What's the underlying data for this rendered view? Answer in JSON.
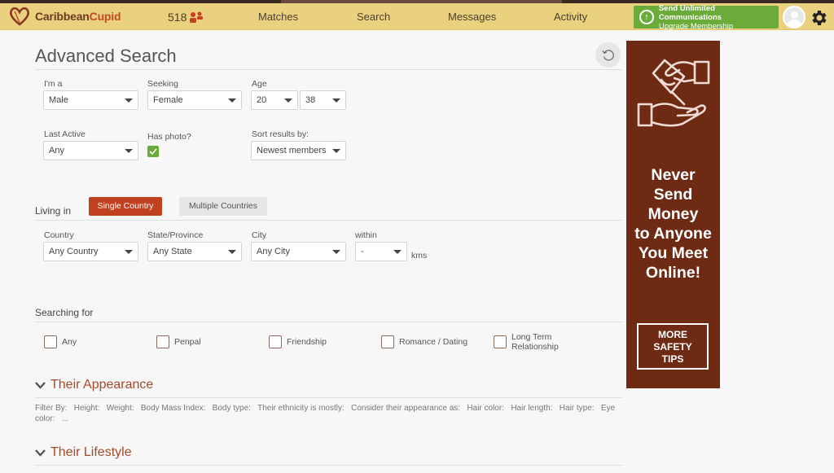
{
  "navbar": {
    "logo_part1": "Caribbean",
    "logo_part2": "Cupid",
    "online_count": "518",
    "nav_items": [
      "Matches",
      "Search",
      "Messages",
      "Activity"
    ],
    "upgrade_title": "Send Unlimited Communications",
    "upgrade_subtitle": "Upgrade Membership",
    "upgrade_icon": "arrow-up-circle-icon",
    "avatar_icon": "user-avatar-icon",
    "settings_icon": "gear-icon"
  },
  "page": {
    "title": "Advanced Search",
    "reset_icon": "reset-icon"
  },
  "basics": {
    "im_a_label": "I'm a",
    "im_a_value": "Male",
    "seeking_label": "Seeking",
    "seeking_value": "Female",
    "age_label": "Age",
    "age_min": "20",
    "age_max": "38",
    "last_active_label": "Last Active",
    "last_active_value": "Any",
    "has_photo_label": "Has photo?",
    "has_photo_checked": true,
    "sort_label": "Sort results by:",
    "sort_value": "Newest members"
  },
  "location": {
    "living_in_label": "Living in",
    "tab_single": "Single Country",
    "tab_multiple": "Multiple Countries",
    "active_tab": "Single Country",
    "country_label": "Country",
    "country_value": "Any Country",
    "state_label": "State/Province",
    "state_value": "Any State",
    "city_label": "City",
    "city_value": "Any City",
    "within_label": "within",
    "within_value": "-",
    "unit": "kms"
  },
  "searching_for": {
    "label": "Searching for",
    "options": [
      {
        "label": "Any",
        "checked": false
      },
      {
        "label": "Penpal",
        "checked": false
      },
      {
        "label": "Friendship",
        "checked": false
      },
      {
        "label": "Romance / Dating",
        "checked": false
      },
      {
        "label": "Long Term Relationship",
        "checked": false
      }
    ]
  },
  "sections": {
    "appearance_title": "Their Appearance",
    "appearance_filters": "Filter By:   Height:   Weight:   Body Mass Index:   Body type:   Their ethnicity is mostly:   Consider their appearance as:   Hair color:   Hair length:   Hair type:   Eye color:   ...",
    "lifestyle_title": "Their Lifestyle"
  },
  "ad": {
    "icon": "hands-money-icon",
    "headline": "Never Send Money to Anyone You Meet Online!",
    "headline_lines": [
      "Never",
      "Send",
      "Money",
      "to Anyone",
      "You Meet",
      "Online!"
    ],
    "button_lines": [
      "MORE",
      "SAFETY",
      "TIPS"
    ],
    "background": "#6f2a14"
  },
  "colors": {
    "navbar": "#ead17f",
    "accent": "#c0401f",
    "upgrade_green": "#6bab3a",
    "section_title": "#a44a2a"
  }
}
